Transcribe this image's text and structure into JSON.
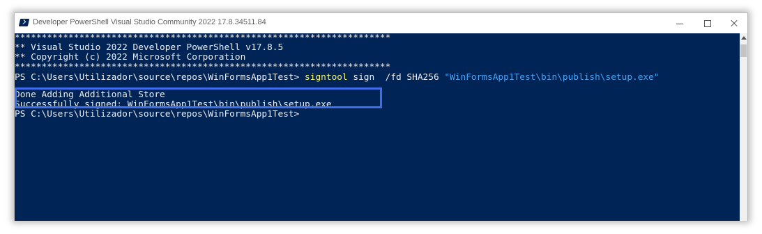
{
  "window": {
    "title": "Developer PowerShell Visual Studio Community 2022 17.8.34511.84"
  },
  "console": {
    "banner_stars": "**********************************************************************",
    "banner_line1": "** Visual Studio 2022 Developer PowerShell v17.8.5",
    "banner_line2": "** Copyright (c) 2022 Microsoft Corporation",
    "prompt1": "PS C:\\Users\\Utilizador\\source\\repos\\WinFormsApp1Test> ",
    "command": "signtool",
    "args": " sign  /fd SHA256 ",
    "path_arg": "\"WinFormsApp1Test\\bin\\publish\\setup.exe\"",
    "output_line1": "Done Adding Additional Store",
    "output_line2": "Successfully signed: WinFormsApp1Test\\bin\\publish\\setup.exe",
    "prompt2": "PS C:\\Users\\Utilizador\\source\\repos\\WinFormsApp1Test>"
  },
  "colors": {
    "console_bg": "#012456",
    "command": "#f6f266",
    "string": "#47a3f5",
    "highlight": "#3f6ee8"
  }
}
